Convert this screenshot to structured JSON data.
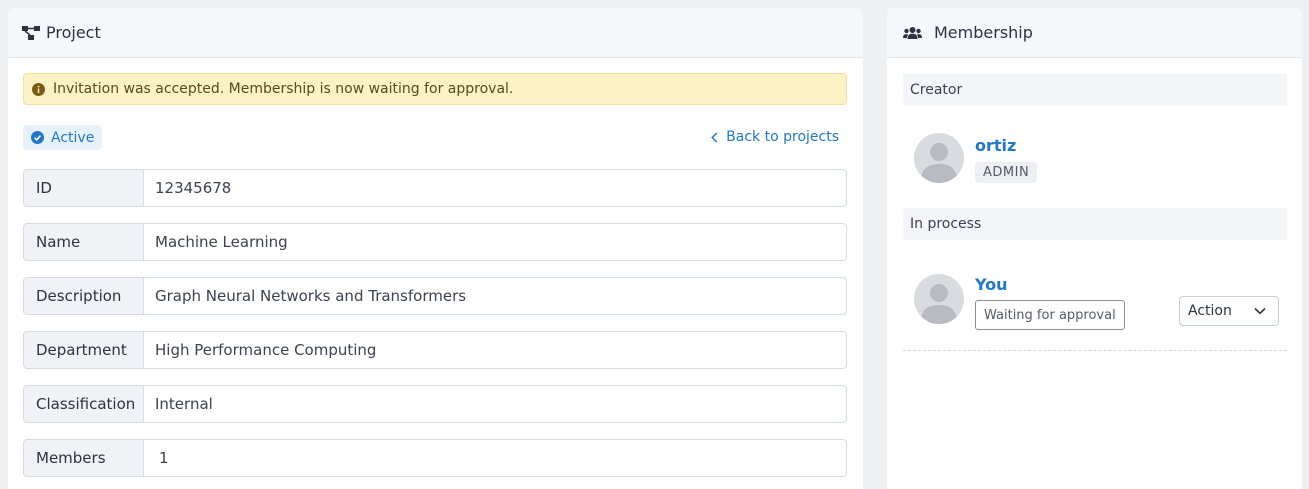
{
  "project": {
    "header_title": "Project",
    "header_icon": "project-diagram-icon",
    "alert": {
      "text": "Invitation was accepted. Membership is now waiting for approval.",
      "icon": "info-circle-icon",
      "bg_color": "#fdf1c6"
    },
    "status": {
      "label": "Active",
      "icon": "check-circle-icon",
      "color": "#1f78c8"
    },
    "back_link": "Back to projects",
    "fields": [
      {
        "label": "ID",
        "value": "12345678"
      },
      {
        "label": "Name",
        "value": "Machine Learning"
      },
      {
        "label": "Description",
        "value": "Graph Neural Networks and Transformers"
      },
      {
        "label": "Department",
        "value": "High Performance Computing"
      },
      {
        "label": "Classification",
        "value": "Internal"
      },
      {
        "label": "Members",
        "value": "1"
      }
    ]
  },
  "membership": {
    "header_title": "Membership",
    "header_icon": "users-icon",
    "creator_section": "Creator",
    "creator": {
      "name": "ortiz",
      "role": "ADMIN"
    },
    "in_process_section": "In process",
    "pending": {
      "name": "You",
      "status": "Waiting for approval",
      "action_label": "Action"
    }
  },
  "colors": {
    "accent": "#1f78c8",
    "page_bg": "#eef0f4",
    "header_bg": "#f6f7fb"
  }
}
